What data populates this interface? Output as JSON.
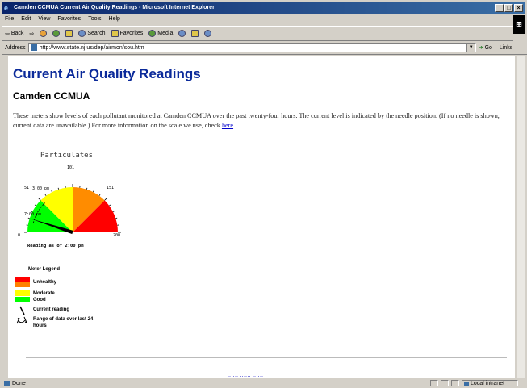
{
  "window": {
    "title": "Camden CCMUA Current Air Quality Readings - Microsoft Internet Explorer",
    "buttons": [
      "_",
      "□",
      "×"
    ]
  },
  "menu": [
    "File",
    "Edit",
    "View",
    "Favorites",
    "Tools",
    "Help"
  ],
  "toolbar": {
    "back": "Back",
    "search": "Search",
    "favorites": "Favorites",
    "media": "Media"
  },
  "address": {
    "label": "Address",
    "url": "http://www.state.nj.us/dep/airmon/sou.htm",
    "go": "Go",
    "links": "Links"
  },
  "page": {
    "title": "Current Air Quality Readings",
    "subtitle": "Camden CCMUA",
    "intro_text": "These meters show levels of each pollutant monitored at Camden CCMUA over the past twenty-four hours. The current level is indicated by the needle position. (If no needle is shown, current data are unavailable.) For more information on the scale we use, check ",
    "intro_link": "here",
    "intro_end": "."
  },
  "gauge": {
    "title": "Particulates",
    "scale_labels": [
      "0",
      "51",
      "101",
      "151",
      "200"
    ],
    "time_labels": [
      "3:00 pm",
      "7:00 pm"
    ],
    "reading_caption": "Reading as of 2:00 pm",
    "range": [
      0,
      200
    ],
    "needle_value": 20,
    "bands": [
      {
        "from": 0,
        "to": 50,
        "color": "#00ff00"
      },
      {
        "from": 50,
        "to": 100,
        "color": "#ffff00"
      },
      {
        "from": 100,
        "to": 150,
        "color": "#ff8c00"
      },
      {
        "from": 150,
        "to": 200,
        "color": "#ff0000"
      }
    ]
  },
  "legend": {
    "heading": "Meter Legend",
    "items": [
      {
        "label": "Unhealthy",
        "colors": [
          "#ff0000",
          "#ff8000"
        ]
      },
      {
        "label": "Moderate",
        "colors": [
          "#ffff00"
        ]
      },
      {
        "label": "Good",
        "colors": [
          "#00ff00"
        ]
      },
      {
        "label": "Current reading"
      },
      {
        "label": "Range of data over last 24 hours"
      }
    ]
  },
  "status": {
    "left": "Done",
    "zone": "Local intranet"
  }
}
